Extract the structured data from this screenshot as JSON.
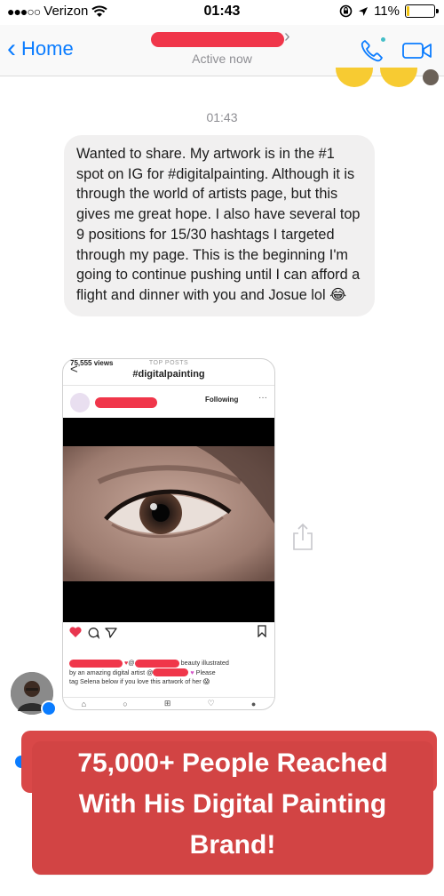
{
  "status_bar": {
    "signal_dots": "●●●○○",
    "carrier": "Verizon",
    "wifi_icon": "wifi-icon",
    "time": "01:43",
    "battery_percent": "11%",
    "battery_level": 0.11,
    "battery_color": "#f1c40f"
  },
  "nav": {
    "back_label": "Home",
    "subtitle": "Active now",
    "accent": "#0a7cff",
    "online_dot_color": "#44bec7"
  },
  "conversation": {
    "timestamp": "01:43",
    "message": "Wanted to share. My artwork is in the #1 spot on IG for #digitalpainting. Although it is through the world of artists page, but this gives me great hope. I also have several top 9 positions for 15/30 hashtags I targeted through my page. This is the beginning I'm going to continue pushing until I can afford a flight and dinner with you and Josue lol 😂"
  },
  "screenshot": {
    "back_glyph": "<",
    "top_label": "TOP POSTS",
    "hashtag": "#digitalpainting",
    "following": "Following",
    "more": "···",
    "views": "75,555 views",
    "caption_a": "beauty illustrated",
    "caption_b": "by an amazing digital artist @",
    "caption_c": "Please",
    "caption_d": "tag Selena below if you love this artwork of her 😱"
  },
  "banner": {
    "line1": "75,000+ People Reached",
    "line2": "With His Digital Painting",
    "line3": "Brand!",
    "color": "#d24444"
  }
}
